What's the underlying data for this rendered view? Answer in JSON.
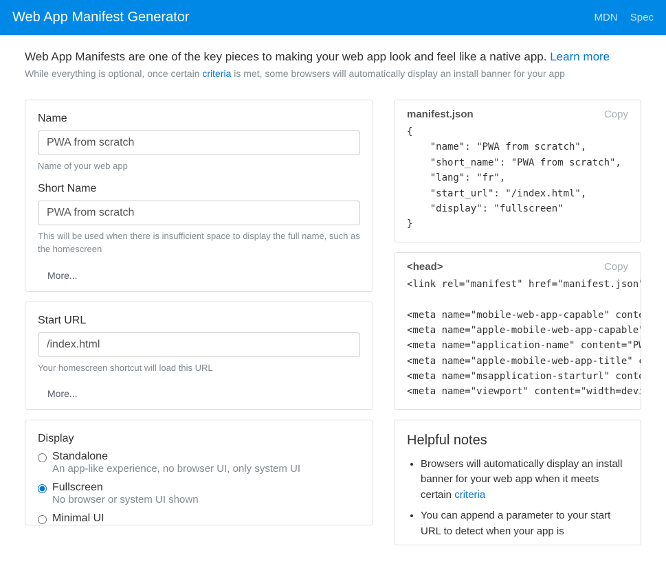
{
  "navbar": {
    "title": "Web App Manifest Generator",
    "links": {
      "mdn": "MDN",
      "spec": "Spec"
    }
  },
  "intro": {
    "lead_pre": "Web App Manifests are one of the key pieces to making your web app look and feel like a native app. ",
    "lead_link": "Learn more",
    "sub_pre": "While everything is optional, once certain ",
    "sub_link": "criteria",
    "sub_post": " is met, some browsers will automatically display an install banner for your app"
  },
  "name": {
    "label": "Name",
    "value": "PWA from scratch",
    "help": "Name of your web app"
  },
  "short_name": {
    "label": "Short Name",
    "value": "PWA from scratch",
    "help": "This will be used when there is insufficient space to display the full name, such as the homescreen"
  },
  "more_label": "More...",
  "start_url": {
    "label": "Start URL",
    "value": "/index.html",
    "help": "Your homescreen shortcut will load this URL"
  },
  "display": {
    "label": "Display",
    "options": {
      "standalone": {
        "label": "Standalone",
        "desc": "An app-like experience, no browser UI, only system UI"
      },
      "fullscreen": {
        "label": "Fullscreen",
        "desc": "No browser or system UI shown"
      },
      "minimal": {
        "label": "Minimal UI",
        "desc": ""
      }
    },
    "selected": "fullscreen"
  },
  "manifest_preview": {
    "title": "manifest.json",
    "copy": "Copy",
    "code": "{\n    \"name\": \"PWA from scratch\",\n    \"short_name\": \"PWA from scratch\",\n    \"lang\": \"fr\",\n    \"start_url\": \"/index.html\",\n    \"display\": \"fullscreen\"\n}"
  },
  "head_preview": {
    "title": "<head>",
    "copy": "Copy",
    "code": "<link rel=\"manifest\" href=\"manifest.json\">\n\n<meta name=\"mobile-web-app-capable\" content=\"yes\">\n<meta name=\"apple-mobile-web-app-capable\" content=\"yes\">\n<meta name=\"application-name\" content=\"PWA from scratch\">\n<meta name=\"apple-mobile-web-app-title\" content=\"PWA from scratch\">\n<meta name=\"msapplication-starturl\" content=\"/index.html\">\n<meta name=\"viewport\" content=\"width=device-width, initial-scale=1\">"
  },
  "notes": {
    "title": "Helpful notes",
    "item1_pre": "Browsers will automatically display an install banner for your web app when it meets certain ",
    "item1_link": "criteria",
    "item2": "You can append a parameter to your start URL to detect when your app is"
  }
}
